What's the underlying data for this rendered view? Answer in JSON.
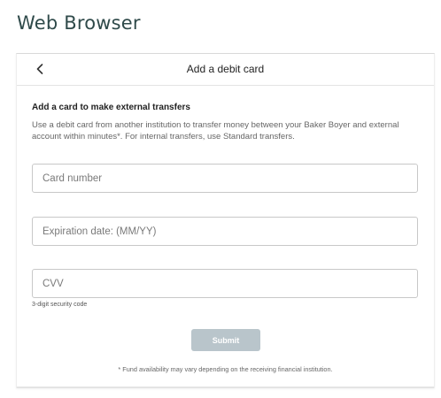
{
  "app": {
    "title": "Web Browser"
  },
  "header": {
    "back_icon": "chevron-left-icon",
    "title": "Add a debit card"
  },
  "intro": {
    "heading": "Add a card to make external transfers",
    "description": "Use a debit card from another institution to transfer money between your Baker Boyer and external account within minutes*. For internal transfers, use Standard transfers."
  },
  "form": {
    "card_number": {
      "placeholder": "Card number",
      "value": ""
    },
    "expiration": {
      "placeholder": "Expiration date: (MM/YY)",
      "value": ""
    },
    "cvv": {
      "placeholder": "CVV",
      "value": "",
      "helper": "3-digit security code"
    },
    "submit_label": "Submit",
    "submit_state": "disabled"
  },
  "footnote": "* Fund availability may vary depending on the receiving financial institution.",
  "colors": {
    "title_text": "#2f4a4a",
    "submit_disabled_bg": "#b9c5cb",
    "field_border": "#c8c8c8",
    "description_text": "#666666"
  }
}
